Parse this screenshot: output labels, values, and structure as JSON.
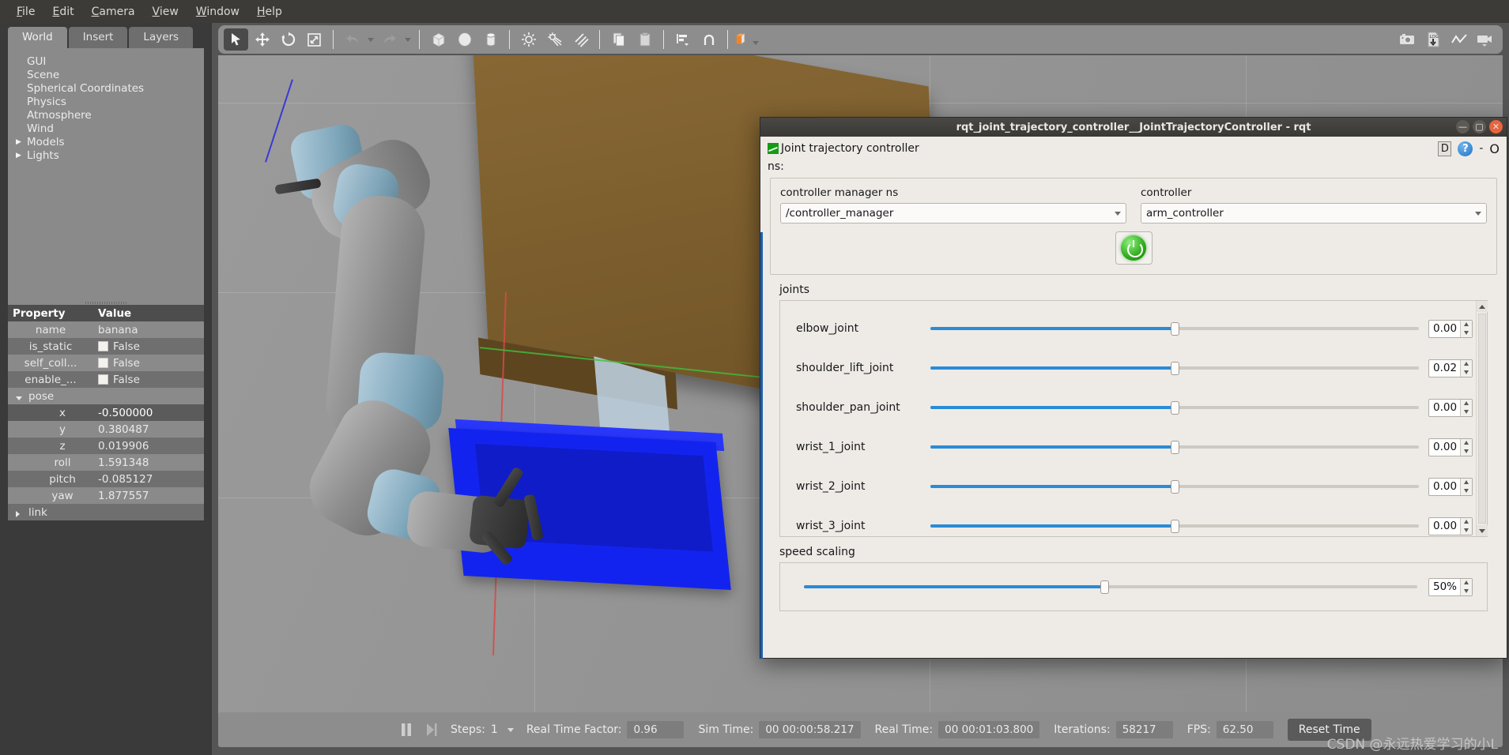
{
  "menubar": {
    "items": [
      {
        "pre": "",
        "u": "F",
        "post": "ile"
      },
      {
        "pre": "",
        "u": "E",
        "post": "dit"
      },
      {
        "pre": "",
        "u": "C",
        "post": "amera"
      },
      {
        "pre": "",
        "u": "V",
        "post": "iew"
      },
      {
        "pre": "",
        "u": "W",
        "post": "indow"
      },
      {
        "pre": "",
        "u": "H",
        "post": "elp"
      }
    ]
  },
  "left_panel": {
    "tabs": [
      {
        "label": "World",
        "active": true
      },
      {
        "label": "Insert",
        "active": false
      },
      {
        "label": "Layers",
        "active": false
      }
    ],
    "tree": [
      {
        "label": "GUI",
        "expandable": false
      },
      {
        "label": "Scene",
        "expandable": false
      },
      {
        "label": "Spherical Coordinates",
        "expandable": false
      },
      {
        "label": "Physics",
        "expandable": false
      },
      {
        "label": "Atmosphere",
        "expandable": false
      },
      {
        "label": "Wind",
        "expandable": false
      },
      {
        "label": "Models",
        "expandable": true
      },
      {
        "label": "Lights",
        "expandable": true
      }
    ],
    "property_table": {
      "headers": [
        "Property",
        "Value"
      ],
      "rows": [
        {
          "name": "name",
          "value": "banana",
          "kind": "text",
          "style": "plain"
        },
        {
          "name": "is_static",
          "value": "False",
          "kind": "check",
          "style": "alt"
        },
        {
          "name": "self_coll...",
          "value": "False",
          "kind": "check",
          "style": "plain"
        },
        {
          "name": "enable_...",
          "value": "False",
          "kind": "check",
          "style": "alt"
        },
        {
          "name": "pose",
          "value": "",
          "kind": "group",
          "style": "plain"
        },
        {
          "name": "x",
          "value": "-0.500000",
          "kind": "text",
          "style": "sel"
        },
        {
          "name": "y",
          "value": "0.380487",
          "kind": "text",
          "style": "plain"
        },
        {
          "name": "z",
          "value": "0.019906",
          "kind": "text",
          "style": "alt"
        },
        {
          "name": "roll",
          "value": "1.591348",
          "kind": "text",
          "style": "plain"
        },
        {
          "name": "pitch",
          "value": "-0.085127",
          "kind": "text",
          "style": "alt"
        },
        {
          "name": "yaw",
          "value": "1.877557",
          "kind": "text",
          "style": "plain"
        },
        {
          "name": "link",
          "value": "",
          "kind": "collapsed",
          "style": "alt"
        }
      ]
    }
  },
  "toolbar": {
    "left_tools": [
      {
        "name": "select-arrow-tool",
        "glyph": "arrow",
        "active": true
      },
      {
        "name": "translate-tool",
        "glyph": "move",
        "active": false
      },
      {
        "name": "rotate-tool",
        "glyph": "rotate",
        "active": false
      },
      {
        "name": "scale-tool",
        "glyph": "scale",
        "active": false
      },
      {
        "name": "undo-button",
        "glyph": "undo",
        "active": false
      },
      {
        "name": "undo-dropdown",
        "glyph": "caret",
        "active": false
      },
      {
        "name": "redo-button",
        "glyph": "redo",
        "active": false
      },
      {
        "name": "redo-dropdown",
        "glyph": "caret",
        "active": false
      },
      {
        "name": "insert-box-button",
        "glyph": "box",
        "active": false
      },
      {
        "name": "insert-sphere-button",
        "glyph": "sphere",
        "active": false
      },
      {
        "name": "insert-cylinder-button",
        "glyph": "cylinder",
        "active": false
      },
      {
        "name": "point-light-button",
        "glyph": "pointlight",
        "active": false
      },
      {
        "name": "spot-light-button",
        "glyph": "spotlight",
        "active": false
      },
      {
        "name": "directional-light-button",
        "glyph": "dirlight",
        "active": false
      },
      {
        "name": "copy-button",
        "glyph": "copy",
        "active": false
      },
      {
        "name": "paste-button",
        "glyph": "paste",
        "active": false
      },
      {
        "name": "align-button",
        "glyph": "align",
        "active": false
      },
      {
        "name": "snap-button",
        "glyph": "snap",
        "active": false
      },
      {
        "name": "view-mode-button",
        "glyph": "viewmode",
        "active": false
      }
    ],
    "right_tools": [
      {
        "name": "screenshot-icon",
        "glyph": "camera"
      },
      {
        "name": "log-record-icon",
        "glyph": "log"
      },
      {
        "name": "plot-icon",
        "glyph": "plot"
      },
      {
        "name": "video-record-icon",
        "glyph": "video"
      }
    ]
  },
  "statusbar": {
    "steps_label": "Steps:",
    "steps_value": "1",
    "rtf_label": "Real Time Factor:",
    "rtf_value": "0.96",
    "sim_time_label": "Sim Time:",
    "sim_time_value": "00 00:00:58.217",
    "real_time_label": "Real Time:",
    "real_time_value": "00 00:01:03.800",
    "iterations_label": "Iterations:",
    "iterations_value": "58217",
    "fps_label": "FPS:",
    "fps_value": "62.50",
    "reset_button": "Reset Time"
  },
  "watermark": "CSDN @永远热爱学习的小L",
  "rqt": {
    "window_title": "rqt_joint_trajectory_controller__JointTrajectoryController - rqt",
    "window_buttons": {
      "minimize": "—",
      "maximize": "▢",
      "close": "✕"
    },
    "plugin_title": "Joint trajectory controller",
    "header_badges": {
      "dock": "D",
      "help": "?",
      "minus": "-",
      "circle": "O"
    },
    "ns_label": "ns:",
    "controller_manager_ns_label": "controller manager ns",
    "controller_manager_ns_value": "/controller_manager",
    "controller_label": "controller",
    "controller_value": "arm_controller",
    "power_button_name": "enable-controller-button",
    "joints_label": "joints",
    "joints": [
      {
        "name": "elbow_joint",
        "value": "0.00",
        "slider_pct": 50
      },
      {
        "name": "shoulder_lift_joint",
        "value": "0.02",
        "slider_pct": 50
      },
      {
        "name": "shoulder_pan_joint",
        "value": "0.00",
        "slider_pct": 50
      },
      {
        "name": "wrist_1_joint",
        "value": "0.00",
        "slider_pct": 50
      },
      {
        "name": "wrist_2_joint",
        "value": "0.00",
        "slider_pct": 50
      },
      {
        "name": "wrist_3_joint",
        "value": "0.00",
        "slider_pct": 50
      }
    ],
    "speed_scaling_label": "speed scaling",
    "speed_scaling_value": "50%",
    "speed_scaling_pct": 49
  },
  "colors": {
    "accent_blue": "#2a8bd6",
    "panel_bg": "#eeebe6",
    "gazebo_grey": "#8a8a8a",
    "bin_blue": "#1323ef",
    "table_brown": "#7d5e2c",
    "power_green": "#2fa81c"
  }
}
